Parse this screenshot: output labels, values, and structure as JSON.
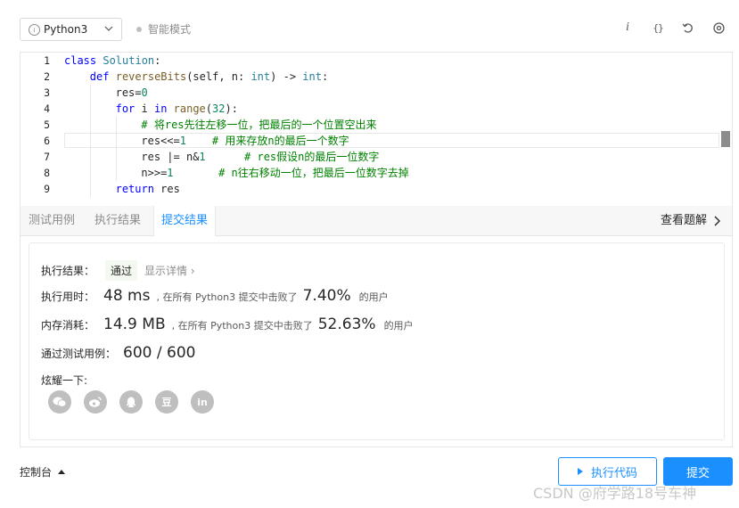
{
  "toolbar": {
    "language": "Python3",
    "mode_label": "智能模式",
    "icons": [
      "info-icon",
      "braces-icon",
      "reset-icon",
      "settings-icon"
    ]
  },
  "editor": {
    "lines": [
      {
        "n": "1",
        "indent": 0,
        "tokens": [
          [
            "kw",
            "class"
          ],
          [
            "",
            " "
          ],
          [
            "cls",
            "Solution"
          ],
          [
            "",
            ":"
          ]
        ]
      },
      {
        "n": "2",
        "indent": 1,
        "tokens": [
          [
            "kw",
            "def"
          ],
          [
            "",
            " "
          ],
          [
            "fn",
            "reverseBits"
          ],
          [
            "",
            "(self, n: "
          ],
          [
            "cls",
            "int"
          ],
          [
            "",
            ") -> "
          ],
          [
            "cls",
            "int"
          ],
          [
            "",
            ":"
          ]
        ]
      },
      {
        "n": "3",
        "indent": 2,
        "tokens": [
          [
            "",
            "res="
          ],
          [
            "num",
            "0"
          ]
        ]
      },
      {
        "n": "4",
        "indent": 2,
        "tokens": [
          [
            "kw",
            "for"
          ],
          [
            "",
            " i "
          ],
          [
            "kw",
            "in"
          ],
          [
            "",
            " "
          ],
          [
            "fn",
            "range"
          ],
          [
            "",
            "("
          ],
          [
            "num",
            "32"
          ],
          [
            "",
            "):"
          ]
        ]
      },
      {
        "n": "5",
        "indent": 3,
        "tokens": [
          [
            "cm",
            "# 将res先往左移一位，把最后的一个位置空出来"
          ]
        ]
      },
      {
        "n": "6",
        "indent": 3,
        "tokens": [
          [
            "",
            "res<<="
          ],
          [
            "num",
            "1"
          ],
          [
            "",
            "    "
          ],
          [
            "cm",
            "# 用来存放n的最后一个数字"
          ]
        ]
      },
      {
        "n": "7",
        "indent": 3,
        "tokens": [
          [
            "",
            "res |= n&"
          ],
          [
            "num",
            "1"
          ],
          [
            "",
            "      "
          ],
          [
            "cm",
            "# res假设n的最后一位数字"
          ]
        ]
      },
      {
        "n": "8",
        "indent": 3,
        "tokens": [
          [
            "",
            "n>>="
          ],
          [
            "num",
            "1"
          ],
          [
            "",
            "       "
          ],
          [
            "cm",
            "# n往右移动一位，把最后一位数字去掉"
          ]
        ]
      },
      {
        "n": "9",
        "indent": 2,
        "tokens": [
          [
            "kw",
            "return"
          ],
          [
            "",
            " res"
          ]
        ]
      }
    ],
    "active_line": 6
  },
  "tabs": {
    "items": [
      "测试用例",
      "执行结果",
      "提交结果"
    ],
    "active": 2,
    "view_solution": "查看题解"
  },
  "result": {
    "status_label": "执行结果：",
    "status_value": "通过",
    "detail_link": "显示详情 ›",
    "runtime_label": "执行用时：",
    "runtime_value": "48 ms",
    "runtime_mid": ", 在所有 Python3 提交中击败了",
    "runtime_pct": "7.40%",
    "runtime_tail": "的用户",
    "memory_label": "内存消耗：",
    "memory_value": "14.9 MB",
    "memory_mid": ", 在所有 Python3 提交中击败了",
    "memory_pct": "52.63%",
    "memory_tail": "的用户",
    "tests_label": "通过测试用例：",
    "tests_value": "600 / 600",
    "share_label": "炫耀一下:",
    "share_icons": [
      "wechat-icon",
      "weibo-icon",
      "qq-icon",
      "douban-icon",
      "linkedin-icon"
    ],
    "share_glyphs": [
      "",
      "",
      "",
      "豆",
      "in"
    ]
  },
  "bottom": {
    "console": "控制台",
    "run": "执行代码",
    "submit": "提交",
    "watermark": "CSDN @府学路18号车神"
  }
}
